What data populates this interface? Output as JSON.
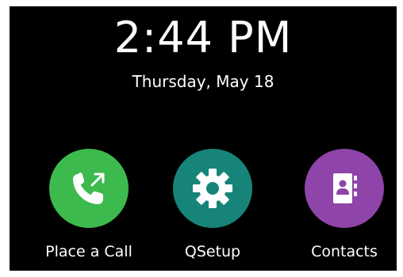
{
  "clock": {
    "time": "2:44 PM",
    "date": "Thursday, May 18"
  },
  "apps": [
    {
      "label": "Place a Call",
      "icon": "phone-outgoing-icon",
      "color": "#3dba4e"
    },
    {
      "label": "QSetup",
      "icon": "gear-icon",
      "color": "#178479"
    },
    {
      "label": "Contacts",
      "icon": "address-book-icon",
      "color": "#8e44a8"
    }
  ]
}
